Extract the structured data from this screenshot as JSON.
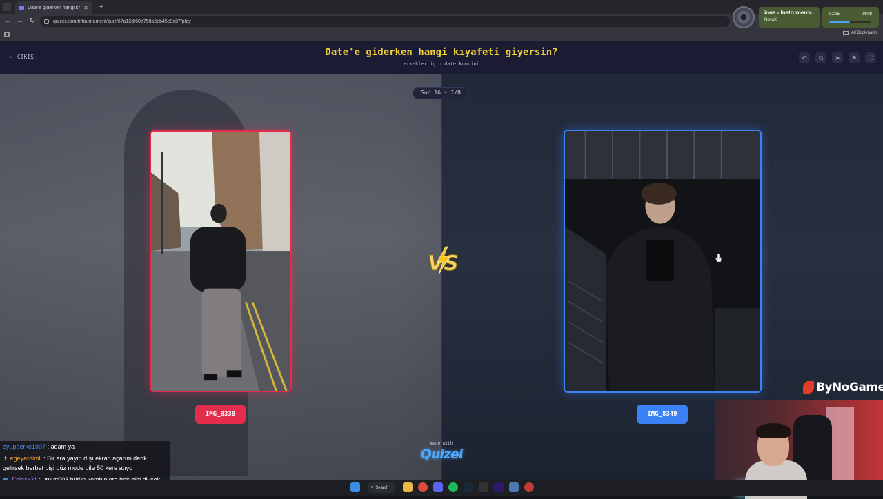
{
  "browser": {
    "tab_title": "Date'e giderken hangi kıyafeti gi...",
    "new_tab_symbol": "+",
    "url": "quizei.com/tr/tournament/quiz/67a12df60b758a6eb45e9c87/play",
    "bookmarks_label": "All Bookmarks"
  },
  "music": {
    "title": "ions - Instrumentc",
    "artist": "NovaX",
    "current_time": "02:05",
    "total_time": "04:08",
    "progress": 0.5
  },
  "header": {
    "exit_label": "ÇIKIŞ",
    "title": "Date'e giderken hangi kıyafeti giyersin?",
    "subtitle": "erkekler için date kombini",
    "actions": [
      "undo-icon",
      "share-icon",
      "send-icon",
      "flag-icon",
      "fullscreen-icon"
    ]
  },
  "round": {
    "label": "Son 16 • 1/8"
  },
  "options": {
    "left": {
      "label": "IMG_8338",
      "color": "#e42c4d"
    },
    "right": {
      "label": "IMG_8349",
      "color": "#3b82f6"
    }
  },
  "footer_brand": {
    "made_with": "made with",
    "logo": "Quizei"
  },
  "sponsor": {
    "name": "ByNoGame"
  },
  "chat": [
    {
      "user": "eyupberke1907",
      "message": "adam ya"
    },
    {
      "user": "egeyardimli",
      "message": "Bir ara yayın dışı ekran açarım denk gelirsek berbat bişi düz mode bile 50 kere atıyo"
    },
    {
      "user": "Felexx21",
      "message": "umutt003 bütün kombinlere bok gibi diycek"
    }
  ],
  "taskbar": {
    "search_label": "Search"
  }
}
